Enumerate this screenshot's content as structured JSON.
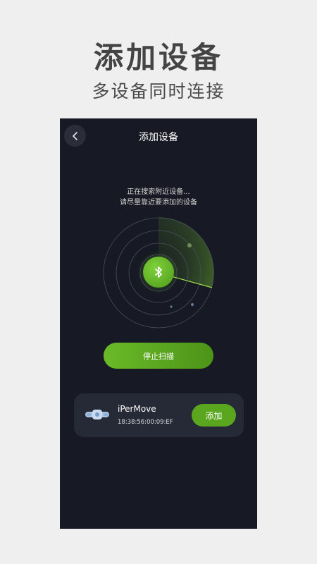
{
  "promo": {
    "title": "添加设备",
    "subtitle": "多设备同时连接"
  },
  "header": {
    "title": "添加设备",
    "back_icon": "chevron-left-icon"
  },
  "scan": {
    "status_line1": "正在搜索附近设备...",
    "status_line2": "请尽量靠近要添加的设备",
    "center_icon": "bluetooth-icon",
    "stop_label": "停止扫描"
  },
  "device": {
    "name": "iPerMove",
    "mac": "18:38:56:00:09:EF",
    "add_label": "添加"
  },
  "colors": {
    "accent": "#5aa61f",
    "background": "#171a24",
    "card": "#262936"
  }
}
